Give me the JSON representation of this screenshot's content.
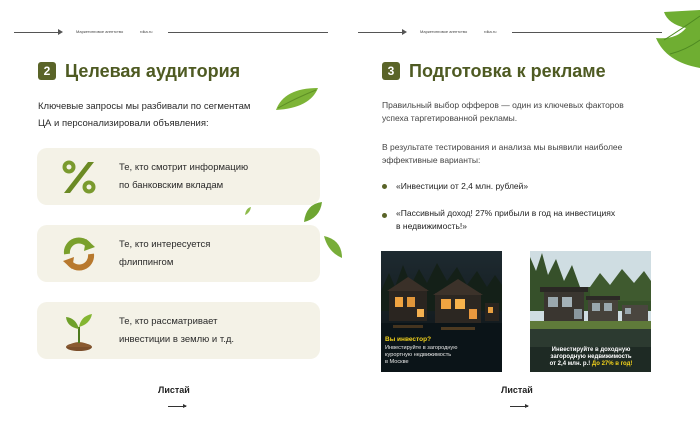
{
  "header": {
    "left_agency": "Маркетинговое агентство",
    "left_site": "rdka.ru",
    "right_agency": "Маркетинговое агентство",
    "right_site": "rdka.ru"
  },
  "left": {
    "number": "2",
    "title": "Целевая аудитория",
    "intro_line1": "Ключевые запросы мы разбивали по сегментам",
    "intro_line2": "ЦА и персонализировали объявления:",
    "cards": [
      {
        "icon": "percent-icon",
        "line1": "Те, кто смотрит информацию",
        "line2": "по банковским вкладам"
      },
      {
        "icon": "recycle-arrows-icon",
        "line1": "Те, кто интересуется",
        "line2": "флиппингом"
      },
      {
        "icon": "sprout-icon",
        "line1": "Те, кто рассматривает",
        "line2": "инвестиции в землю и т.д."
      }
    ],
    "swipe_label": "Листай"
  },
  "right": {
    "number": "3",
    "title": "Подготовка к рекламе",
    "para1_line1": "Правильный выбор офферов — один из ключевых факторов",
    "para1_line2": "успеха таргетированной рекламы.",
    "para2_line1": "В результате тестирования и анализа мы выявили наиболее",
    "para2_line2": "эффективные варианты:",
    "bullets": [
      {
        "line1": "«Инвестиции от 2,4 млн. рублей»",
        "line2": ""
      },
      {
        "line1": "«Пассивный доход! 27% прибыли в год на инвестициях",
        "line2": "в недвижимость!»"
      }
    ],
    "ad1": {
      "headline": "Вы инвестор?",
      "line1": "Инвестируйте в загородную",
      "line2": "курортную недвижимость",
      "line3": "в Москве"
    },
    "ad2": {
      "line1": "Инвестируйте в доходную",
      "line2": "загородную недвижимость",
      "line3_a": "от 2,4 млн. р.! ",
      "line3_b": "До 27% в год!"
    },
    "swipe_label": "Листай"
  },
  "colors": {
    "accent": "#5a6428",
    "card_bg": "#f4f2e7",
    "title": "#4e5a22",
    "highlight": "#f2d21b"
  }
}
